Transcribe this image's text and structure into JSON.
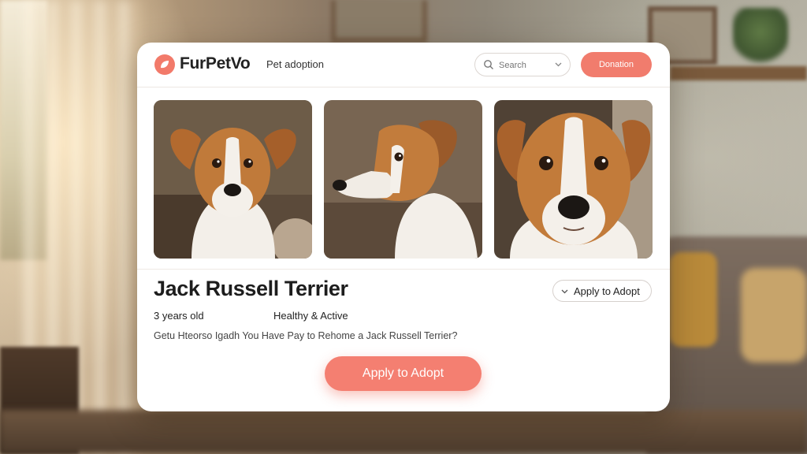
{
  "header": {
    "brand": "FurPetVo",
    "nav_link": "Pet adoption",
    "search_placeholder": "Search",
    "cta_label": "Donation"
  },
  "photos": [
    {
      "alt": "Jack Russell Terrier front view",
      "icon": "dog-photo"
    },
    {
      "alt": "Jack Russell Terrier side profile",
      "icon": "dog-photo"
    },
    {
      "alt": "Jack Russell Terrier close-up",
      "icon": "dog-photo"
    }
  ],
  "pet": {
    "name": "Jack Russell Terrier",
    "age": "3 years old",
    "health": "Healthy & Active",
    "question": "Getu Hteorso Igadh You Have Pay to Rehome a Jack Russell Terrier?"
  },
  "actions": {
    "apply_secondary": "Apply to Adopt",
    "apply_primary": "Apply to Adopt"
  },
  "colors": {
    "accent": "#f27a6a",
    "text": "#1d1d1d",
    "card": "#ffffff"
  }
}
